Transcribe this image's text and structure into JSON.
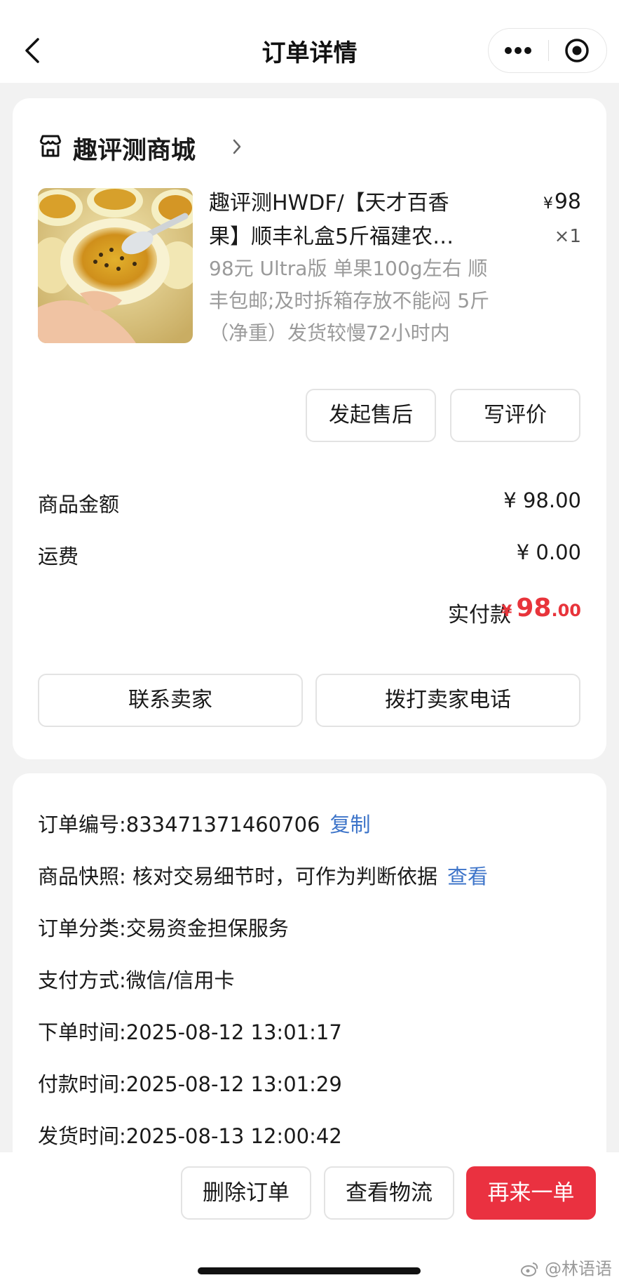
{
  "header": {
    "title": "订单详情"
  },
  "shop": {
    "name": "趣评测商城"
  },
  "product": {
    "title": "趣评测HWDF/【天才百香果】顺丰礼盒5斤福建农…",
    "sku": "98元 Ultra版 单果100g左右 顺丰包邮;及时拆箱存放不能闷 5斤（净重）发货较慢72小时内",
    "currency": "¥",
    "price": "98",
    "quantity": "×1"
  },
  "actions": {
    "after_sale": "发起售后",
    "review": "写评价"
  },
  "summary": {
    "goods_label": "商品金额",
    "goods_value": "¥ 98.00",
    "shipping_label": "运费",
    "shipping_value": "¥ 0.00",
    "paid_label": "实付款",
    "paid_currency": "¥",
    "paid_int": "98",
    "paid_dec": ".00"
  },
  "contact": {
    "contact_seller": "联系卖家",
    "call_seller": "拨打卖家电话"
  },
  "order_info": {
    "order_no": "订单编号:833471371460706",
    "copy": "复制",
    "snapshot": "商品快照: 核对交易细节时，可作为判断依据",
    "view": "查看",
    "category": "订单分类:交易资金担保服务",
    "payment": "支付方式:微信/信用卡",
    "order_time": "下单时间:2025-08-12 13:01:17",
    "pay_time": "付款时间:2025-08-12 13:01:29",
    "ship_time": "发货时间:2025-08-13 12:00:42"
  },
  "bottom_bar": {
    "delete": "删除订单",
    "logistics": "查看物流",
    "reorder": "再来一单"
  },
  "watermark": "@林语语",
  "colors": {
    "accent_red": "#e8343b",
    "link_blue": "#3d74c9",
    "reorder_bg": "#ea3140"
  },
  "icons": [
    "back-arrow-icon",
    "more-dots-icon",
    "target-circle-icon",
    "store-icon",
    "chevron-right-icon",
    "weibo-icon"
  ]
}
